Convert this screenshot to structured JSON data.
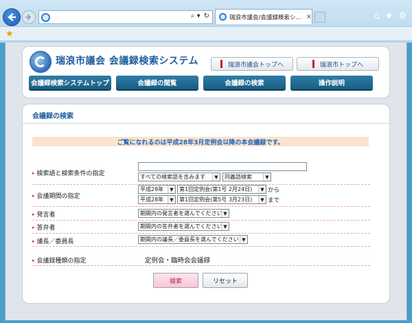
{
  "browser": {
    "tab_title": "瑞浪市議会/会議録検索シ...",
    "tab_close": "×",
    "address_icons": [
      "⌕ ▾",
      "↻"
    ],
    "right_icons": [
      "⌂",
      "★",
      "⚙"
    ]
  },
  "header": {
    "site_title": "瑞浪市議会 会議録検索システム",
    "top_links": [
      "瑞浪市議会トップへ",
      "瑞浪市トップへ"
    ],
    "menu": [
      "会議録検索システムトップ",
      "会議録の閲覧",
      "会議録の検索",
      "操作説明"
    ]
  },
  "search": {
    "section_title": "会議録の検索",
    "notice": "ご覧になれるのは平成28年3月定例会以降の本会議録です。",
    "rows": {
      "keywords_label": "検索語と検索条件の指定",
      "period_label": "会議期間の指定",
      "speaker_label": "発言者",
      "answerer_label": "答弁者",
      "chair_label": "議長／委員長",
      "type_label": "会議録種類の指定"
    },
    "keyword_value": "",
    "condition_select": "すべての検索語を含みます",
    "synonym_select": "同義語検索",
    "from_year": "平成28年",
    "from_meeting": "第1回定例会(第1号 2月24日)",
    "from_suffix": "から",
    "to_year": "平成28年",
    "to_meeting": "第1回定例会(第5号 3月23日)",
    "to_suffix": "まで",
    "speaker_select": "期間内の発言者を選んでください",
    "answerer_select": "期間内の答弁者を選んでください",
    "chair_select": "期間内の議長／委員長を選んでください",
    "type_text": "定例会・臨時会会議録",
    "search_button": "検索",
    "reset_button": "リセット"
  }
}
